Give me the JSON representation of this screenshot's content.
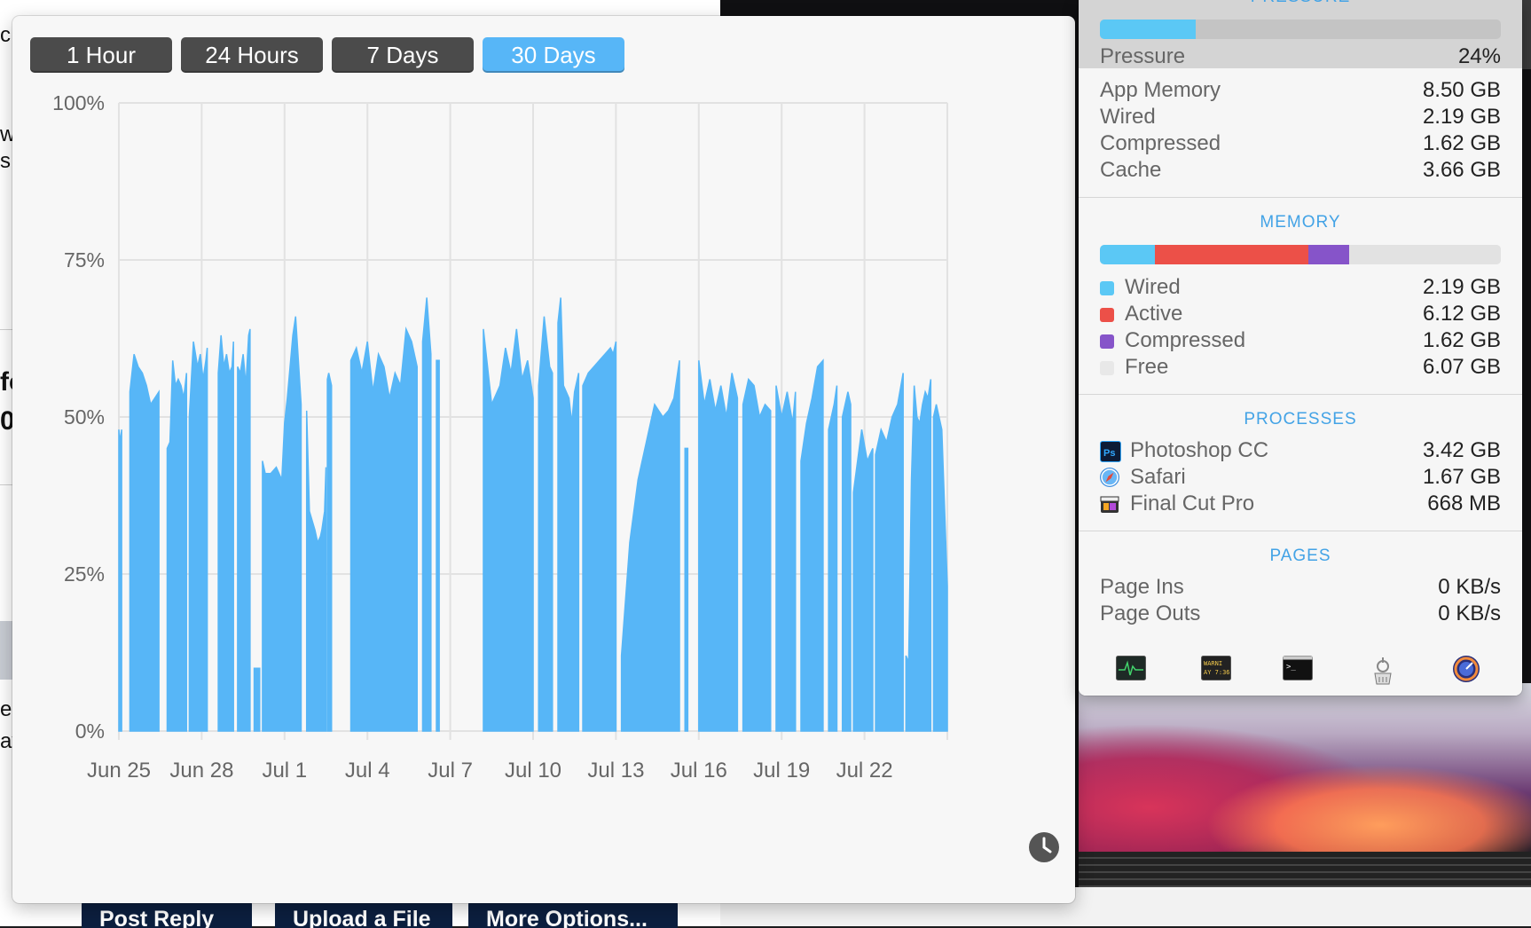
{
  "background": {
    "left_fragments": [
      "c",
      "wi",
      "s",
      "fc",
      "0",
      "ec",
      "av"
    ],
    "buttons": [
      "Post Reply",
      "Upload a File",
      "More Options..."
    ]
  },
  "chart_window": {
    "range_tabs": [
      {
        "label": "1 Hour",
        "active": false
      },
      {
        "label": "24 Hours",
        "active": false
      },
      {
        "label": "7 Days",
        "active": false
      },
      {
        "label": "30 Days",
        "active": true
      }
    ],
    "history_icon": "clock-icon"
  },
  "chart_data": {
    "type": "area",
    "title": "",
    "xlabel": "",
    "ylabel": "",
    "ylim": [
      0,
      100
    ],
    "y_ticks": [
      "100%",
      "75%",
      "50%",
      "25%",
      "0%"
    ],
    "x_ticks": [
      "Jun 25",
      "Jun 28",
      "Jul 1",
      "Jul 4",
      "Jul 7",
      "Jul 10",
      "Jul 13",
      "Jul 16",
      "Jul 19",
      "Jul 22"
    ],
    "x_range_days": [
      0,
      30
    ],
    "grid": true,
    "color": "#57b6f7",
    "series": [
      {
        "segments": [
          {
            "x": [
              0.0,
              0.05,
              0.1
            ],
            "y": [
              48,
              46,
              48
            ]
          },
          {
            "x": [
              0.4,
              0.55,
              0.7,
              0.85,
              1.0,
              1.15,
              1.3,
              1.45
            ],
            "y": [
              54,
              60,
              58,
              57,
              55,
              52,
              53,
              54
            ]
          },
          {
            "x": [
              1.75,
              1.85,
              1.95,
              2.05,
              2.15,
              2.25,
              2.35,
              2.45
            ],
            "y": [
              45,
              46,
              59,
              55,
              56,
              55,
              53,
              57
            ]
          },
          {
            "x": [
              2.55,
              2.7,
              2.85,
              2.95,
              3.05,
              3.15,
              3.2
            ],
            "y": [
              50,
              62,
              58,
              60,
              56,
              59,
              61
            ]
          },
          {
            "x": [
              3.6,
              3.7,
              3.8,
              3.9,
              4.0,
              4.1,
              4.15
            ],
            "y": [
              57,
              63,
              58,
              60,
              57,
              58,
              62
            ]
          },
          {
            "x": [
              4.3,
              4.4,
              4.5,
              4.6,
              4.7,
              4.75
            ],
            "y": [
              58,
              57,
              60,
              55,
              63,
              64
            ]
          },
          {
            "x": [
              4.9,
              5.0,
              5.1
            ],
            "y": [
              10,
              10,
              10
            ]
          },
          {
            "x": [
              5.2,
              5.3,
              5.5,
              5.7,
              5.9,
              6.0,
              6.1,
              6.3,
              6.4,
              6.6
            ],
            "y": [
              43,
              41,
              41,
              42,
              40,
              49,
              53,
              63,
              66,
              52
            ]
          },
          {
            "x": [
              6.8,
              6.9,
              7.1,
              7.2,
              7.3,
              7.35,
              7.45,
              7.5
            ],
            "y": [
              51,
              35,
              32,
              30,
              31,
              32,
              35,
              42
            ]
          },
          {
            "x": [
              7.55,
              7.6,
              7.65,
              7.7
            ],
            "y": [
              56,
              57,
              56,
              55
            ]
          },
          {
            "x": [
              8.4,
              8.6,
              8.8,
              9.0,
              9.2,
              9.4,
              9.6,
              9.8,
              10.0,
              10.2,
              10.4,
              10.6,
              10.8
            ],
            "y": [
              59,
              61,
              57,
              62,
              54,
              60,
              58,
              53,
              57,
              55,
              64,
              62,
              58
            ]
          },
          {
            "x": [
              11.0,
              11.15,
              11.3
            ],
            "y": [
              62,
              69,
              60
            ]
          },
          {
            "x": [
              11.5,
              11.6
            ],
            "y": [
              59,
              59
            ]
          },
          {
            "x": [
              13.2,
              13.5,
              13.8,
              14.0,
              14.2,
              14.4,
              14.6,
              14.8,
              15.0
            ],
            "y": [
              64,
              52,
              55,
              61,
              57,
              64,
              56,
              59,
              53
            ]
          },
          {
            "x": [
              15.2,
              15.4,
              15.6,
              15.7
            ],
            "y": [
              55,
              66,
              58,
              57
            ]
          },
          {
            "x": [
              15.9,
              16.0,
              16.1,
              16.2,
              16.3,
              16.4,
              16.5,
              16.65
            ],
            "y": [
              65,
              69,
              55,
              54,
              53,
              49,
              54,
              57
            ]
          },
          {
            "x": [
              16.8,
              17.0,
              17.2,
              17.4,
              17.6,
              17.8,
              17.9,
              18.0
            ],
            "y": [
              55,
              57,
              58,
              59,
              60,
              61,
              60,
              62
            ]
          },
          {
            "x": [
              18.2,
              18.5,
              18.8,
              19.1,
              19.4,
              19.7,
              19.9,
              20.1,
              20.3
            ],
            "y": [
              12,
              30,
              40,
              46,
              52,
              50,
              51,
              53,
              59
            ]
          },
          {
            "x": [
              20.5,
              20.6
            ],
            "y": [
              45,
              45
            ]
          },
          {
            "x": [
              21.0,
              21.2,
              21.4,
              21.6,
              21.8,
              22.0,
              22.2,
              22.4
            ],
            "y": [
              59,
              52,
              56,
              51,
              55,
              50,
              57,
              53
            ]
          },
          {
            "x": [
              22.6,
              22.8,
              23.0,
              23.2,
              23.4,
              23.6
            ],
            "y": [
              52,
              56,
              55,
              50,
              52,
              51
            ]
          },
          {
            "x": [
              23.8,
              24.0,
              24.2,
              24.4,
              24.5
            ],
            "y": [
              55,
              50,
              54,
              49,
              54
            ]
          },
          {
            "x": [
              24.7,
              24.9,
              25.1,
              25.3,
              25.5
            ],
            "y": [
              43,
              49,
              53,
              58,
              59
            ]
          },
          {
            "x": [
              25.7,
              25.9,
              26.0
            ],
            "y": [
              48,
              52,
              55
            ]
          },
          {
            "x": [
              26.2,
              26.4,
              26.5
            ],
            "y": [
              50,
              54,
              52
            ]
          },
          {
            "x": [
              26.6,
              26.9,
              27.1,
              27.3
            ],
            "y": [
              38,
              48,
              43,
              45
            ]
          },
          {
            "x": [
              27.4,
              27.6,
              27.8,
              28.0,
              28.2,
              28.4
            ],
            "y": [
              44,
              48,
              46,
              50,
              52,
              57
            ]
          },
          {
            "x": [
              28.5,
              28.6,
              28.7,
              28.8,
              28.9,
              29.0,
              29.1,
              29.2,
              29.3,
              29.4
            ],
            "y": [
              12,
              11,
              40,
              55,
              50,
              49,
              52,
              54,
              53,
              56
            ]
          },
          {
            "x": [
              29.5,
              29.6,
              29.8,
              30.0
            ],
            "y": [
              50,
              52,
              48,
              23
            ]
          }
        ]
      }
    ]
  },
  "stats_panel": {
    "pressure_heading": "PRESSURE",
    "pressure": {
      "label": "Pressure",
      "value": "24%",
      "fraction": 0.24,
      "color": "#5bc8f5"
    },
    "memory_summary": [
      {
        "label": "App Memory",
        "value": "8.50 GB"
      },
      {
        "label": "Wired",
        "value": "2.19 GB"
      },
      {
        "label": "Compressed",
        "value": "1.62 GB"
      },
      {
        "label": "Cache",
        "value": "3.66 GB"
      }
    ],
    "memory_heading": "MEMORY",
    "memory_breakdown": [
      {
        "label": "Wired",
        "value": "2.19 GB",
        "gb": 2.19,
        "color": "#5bc8f5"
      },
      {
        "label": "Active",
        "value": "6.12 GB",
        "gb": 6.12,
        "color": "#ec5048"
      },
      {
        "label": "Compressed",
        "value": "1.62 GB",
        "gb": 1.62,
        "color": "#8654c9"
      },
      {
        "label": "Free",
        "value": "6.07 GB",
        "gb": 6.07,
        "color": "#e2e2e2"
      }
    ],
    "processes_heading": "PROCESSES",
    "processes": [
      {
        "label": "Photoshop CC",
        "value": "3.42 GB",
        "icon": "photoshop-icon"
      },
      {
        "label": "Safari",
        "value": "1.67 GB",
        "icon": "safari-icon"
      },
      {
        "label": "Final Cut Pro",
        "value": "668 MB",
        "icon": "final-cut-pro-icon"
      }
    ],
    "pages_heading": "PAGES",
    "pages": [
      {
        "label": "Page Ins",
        "value": "0 KB/s"
      },
      {
        "label": "Page Outs",
        "value": "0 KB/s"
      }
    ],
    "tools": [
      {
        "name": "activity-monitor-icon"
      },
      {
        "name": "console-icon",
        "text": "WARNI\nAY 7:36"
      },
      {
        "name": "terminal-icon",
        "text": ">_"
      },
      {
        "name": "disk-utility-icon"
      },
      {
        "name": "istat-icon"
      }
    ]
  }
}
